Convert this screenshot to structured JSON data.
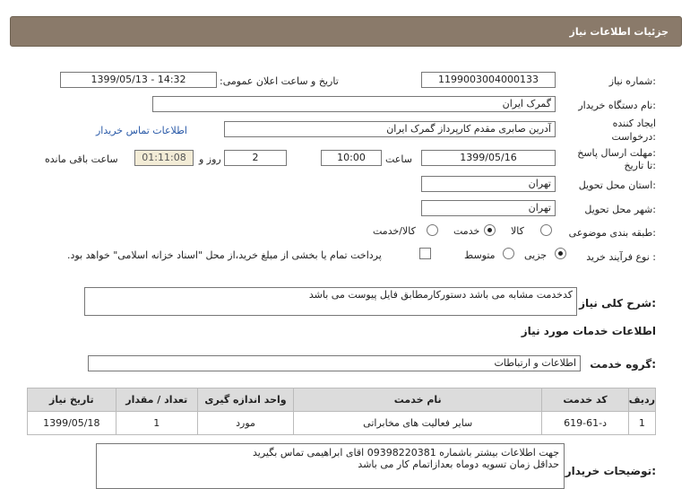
{
  "header": {
    "title": "جزئیات اطلاعات نیاز"
  },
  "need_number": {
    "label": "شماره نیاز:",
    "value": "1199003004000133"
  },
  "announce": {
    "label": "تاریخ و ساعت اعلان عمومی:",
    "value": "1399/05/13 - 14:32"
  },
  "buyer_org": {
    "label": "نام دستگاه خریدار:",
    "value": "گمرک ایران"
  },
  "creator": {
    "label1": "ایجاد کننده",
    "label2": "درخواست:",
    "value": "آدرین صابری مقدم کارپرداز گمرک ایران",
    "contact_link": "اطلاعات تماس خریدار"
  },
  "deadline": {
    "label1": "مهلت ارسال پاسخ:",
    "label2": "تا تاریخ:",
    "date": "1399/05/16",
    "time_label": "ساعت",
    "time": "10:00",
    "days": "2",
    "days_label": "روز و",
    "remaining": "01:11:08",
    "remaining_label": "ساعت باقی مانده"
  },
  "province": {
    "label": "استان محل تحویل:",
    "value": "تهران"
  },
  "city": {
    "label": "شهر محل تحویل:",
    "value": "تهران"
  },
  "category": {
    "label": "طبقه بندی موضوعی:",
    "options": [
      "کالا",
      "خدمت",
      "کالا/خدمت"
    ],
    "selected": "خدمت"
  },
  "process": {
    "label": "نوع فرآیند خرید :",
    "options": [
      "جزیی",
      "متوسط"
    ],
    "selected": "جزیی",
    "payment_note": "پرداخت تمام یا بخشی از مبلغ خرید،از محل \"اسناد خزانه اسلامی\" خواهد بود."
  },
  "description": {
    "label": "شرح کلی نیاز:",
    "value": "کدخدمت مشابه می باشد دستورکارمطابق فایل پیوست می باشد"
  },
  "services_title": "اطلاعات خدمات مورد نیاز",
  "service_group": {
    "label": "گروه خدمت:",
    "value": "اطلاعات و ارتباطات"
  },
  "table": {
    "headers": [
      "ردیف",
      "کد خدمت",
      "نام خدمت",
      "واحد اندازه گیری",
      "تعداد / مقدار",
      "تاریخ نیاز"
    ],
    "rows": [
      [
        "1",
        "د-61-619",
        "سایر فعالیت های مخابراتی",
        "مورد",
        "1",
        "1399/05/18"
      ]
    ]
  },
  "buyer_notes": {
    "label": "توضیحات خریدار:",
    "lines": [
      "جهت اطلاعات بیشتر باشماره 09398220381 اقای ابراهیمی تماس بگیرید",
      "حداقل زمان تسویه دوماه بعدازاتمام کار می باشد"
    ]
  }
}
